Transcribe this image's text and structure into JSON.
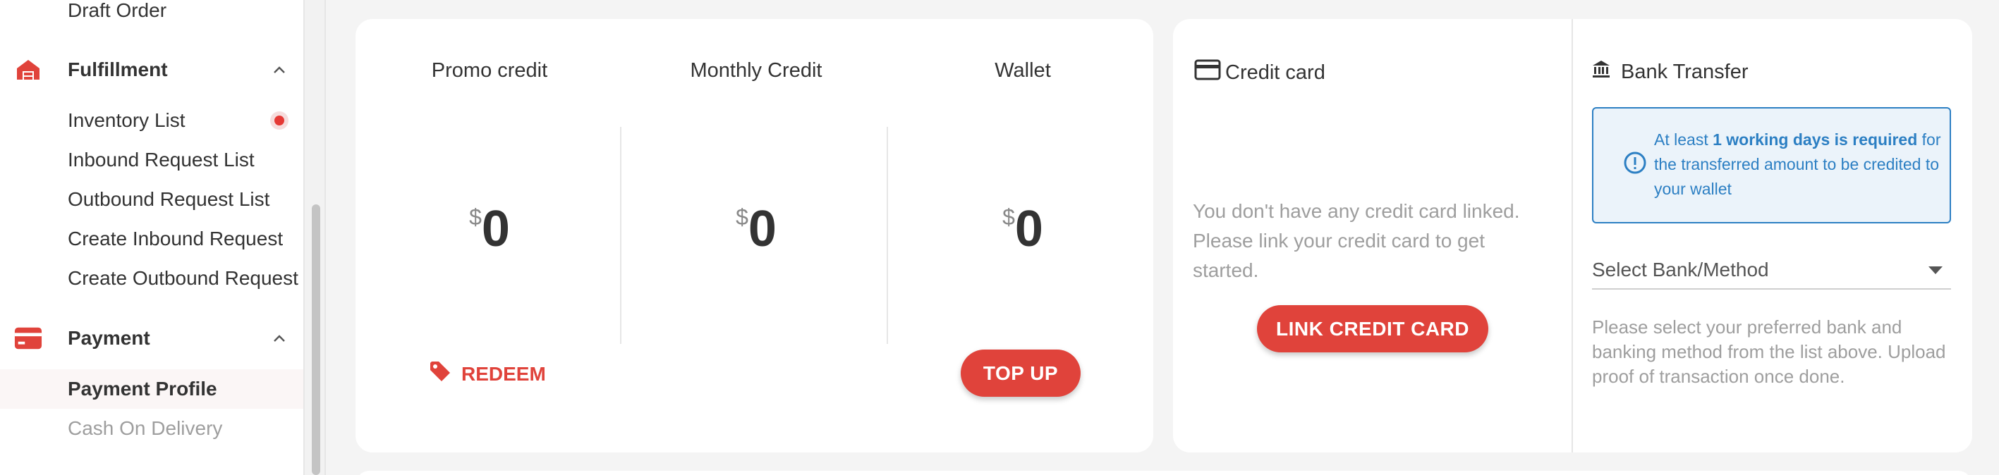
{
  "sidebar": {
    "draft_order": "Draft Order",
    "fulfillment": {
      "title": "Fulfillment",
      "items": [
        "Inventory List",
        "Inbound Request List",
        "Outbound Request List",
        "Create Inbound Request",
        "Create Outbound Request"
      ]
    },
    "payment": {
      "title": "Payment",
      "items": [
        "Payment Profile",
        "Cash On Delivery"
      ]
    }
  },
  "balances": {
    "promo": {
      "label": "Promo credit",
      "currency": "$",
      "value": "0"
    },
    "monthly": {
      "label": "Monthly Credit",
      "currency": "$",
      "value": "0"
    },
    "wallet": {
      "label": "Wallet",
      "currency": "$",
      "value": "0"
    },
    "redeem_label": "REDEEM",
    "topup_label": "TOP UP"
  },
  "credit_card": {
    "title": "Credit card",
    "message": "You don't have any credit card linked. Please link your credit card to get started.",
    "link_button": "LINK CREDIT CARD"
  },
  "bank_transfer": {
    "title": "Bank Transfer",
    "info_prefix": "At least ",
    "info_bold": "1 working days is required",
    "info_suffix": " for the transferred amount to be credited to your wallet",
    "select_placeholder": "Select Bank/Method",
    "help": "Please select your preferred bank and banking method from the list above. Upload proof of transaction once done."
  },
  "colors": {
    "accent": "#e0433b",
    "info": "#2c7fc3",
    "info_bg": "#ebf3fa"
  },
  "icons": [
    "warehouse-icon",
    "chevron-up-icon",
    "payment-card-icon",
    "tag-icon",
    "credit-card-icon",
    "bank-icon",
    "info-icon",
    "dropdown-arrow-icon"
  ]
}
